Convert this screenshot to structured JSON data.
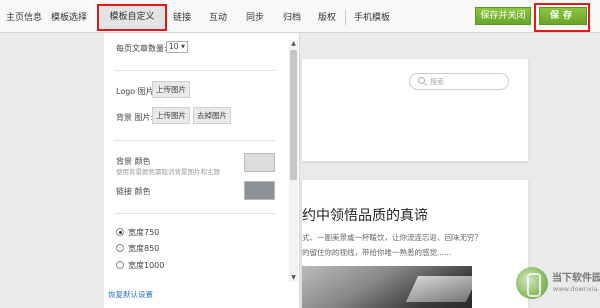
{
  "nav": {
    "items": [
      "主页信息",
      "模板选择",
      "模板自定义",
      "链接",
      "互动",
      "同步",
      "归档",
      "版权",
      "手机模板"
    ],
    "active": "模板自定义"
  },
  "actions": {
    "save_close": "保存并关闭",
    "save": "保存"
  },
  "panel": {
    "per_page_label": "每页文章数量:",
    "per_page_value": "10",
    "logo_label": "Logo 图片:",
    "logo_upload": "上传图片",
    "bg_image_label": "背景 图片:",
    "bg_upload": "上传图片",
    "bg_remove": "去掉图片",
    "bg_color_label": "背景 颜色",
    "bg_color_hint": "使用背景颜色需取消背景图片和主题",
    "link_color_label": "链接 颜色",
    "width_options": [
      "宽度750",
      "宽度850",
      "宽度1000"
    ],
    "width_selected": "宽度750",
    "restore_link": "恢复默认设置",
    "colors": {
      "bg_swatch": "#dcdcdc",
      "link_swatch": "#8a9197"
    }
  },
  "preview": {
    "search_placeholder": "搜索",
    "headline": "约中领悟品质的真谛",
    "line1": "式、一副美景或一杯暖饮，让你流连忘返、回味无穷？",
    "line2": "的留住你的视线，带给你唯一熟悉的感觉......"
  },
  "watermark": {
    "title": "当下软件园",
    "url": "www.downxia.com"
  },
  "colors": {
    "accent_red": "#e0191b",
    "button_green": "#79b534",
    "link_blue": "#2a6fc9"
  }
}
